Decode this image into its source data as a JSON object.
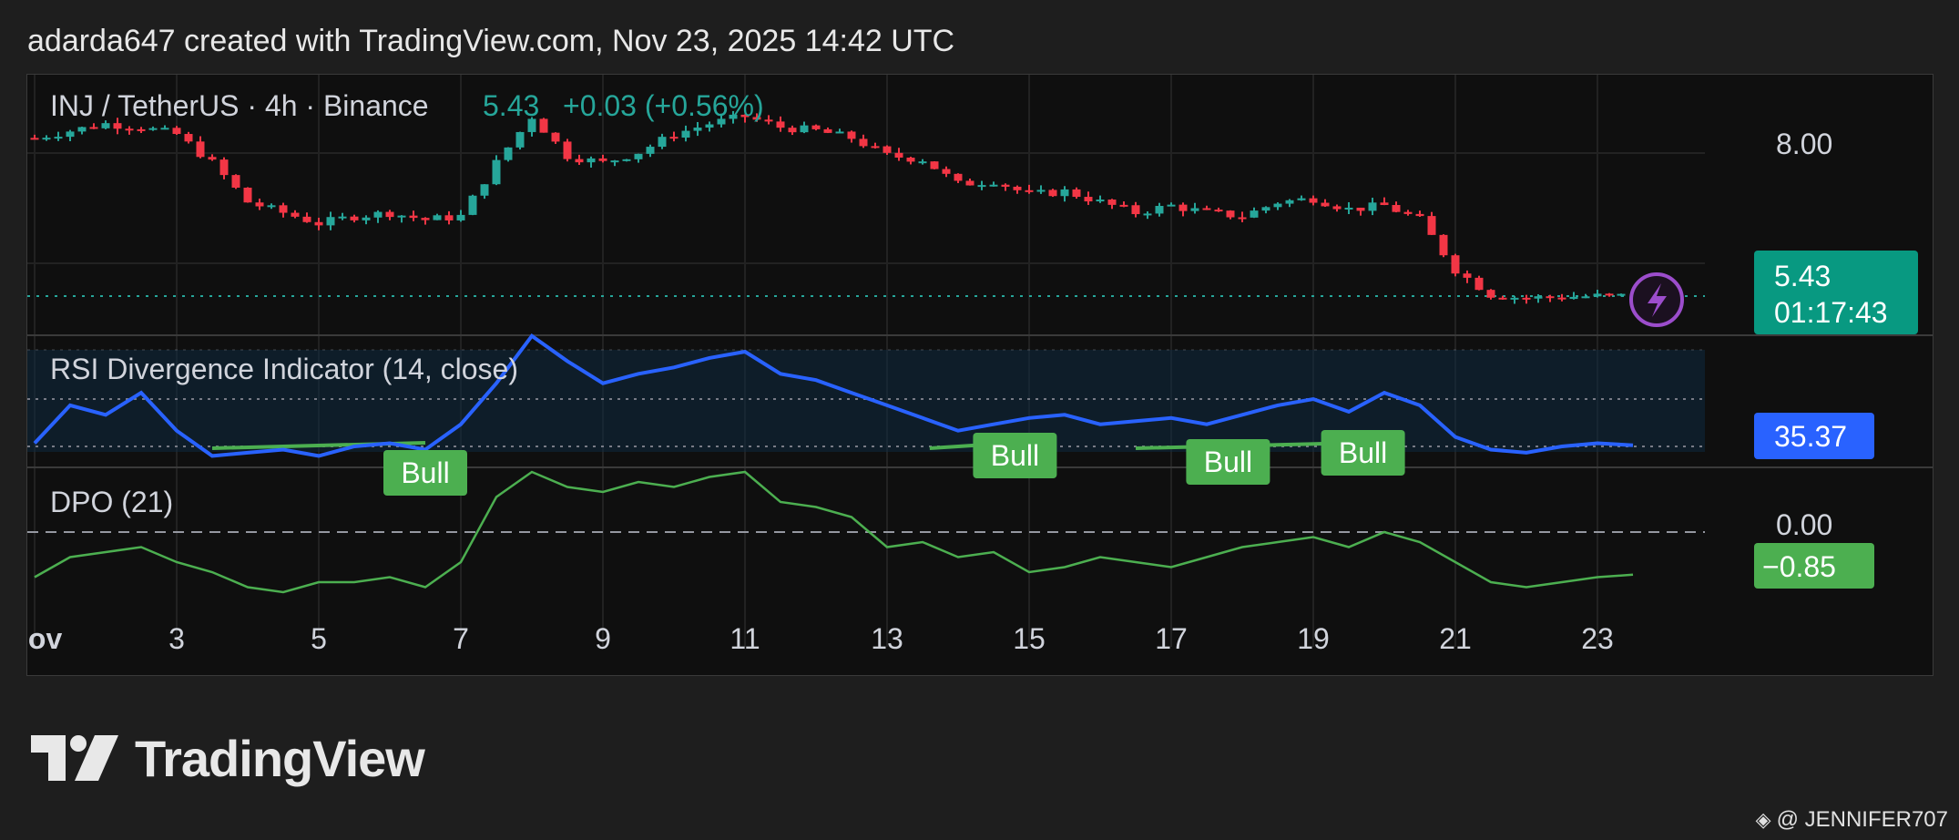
{
  "header": {
    "text": "adarda647 created with TradingView.com, Nov 23, 2025 14:42 UTC"
  },
  "price_pane": {
    "symbol_label": "INJ / TetherUS · 4h · Binance",
    "last_price": "5.43",
    "change": "+0.03 (+0.56%)",
    "axis_label_8": "8.00",
    "price_tag": "5.43",
    "countdown": "01:17:43"
  },
  "rsi_pane": {
    "label": "RSI Divergence Indicator (14, close)",
    "value_tag": "35.37",
    "bull_labels": [
      "Bull",
      "Bull",
      "Bull",
      "Bull"
    ]
  },
  "dpo_pane": {
    "label": "DPO (21)",
    "zero_label": "0.00",
    "value_tag": "−0.85"
  },
  "x_axis": {
    "ticks": [
      "Nov",
      "3",
      "5",
      "7",
      "9",
      "11",
      "13",
      "15",
      "17",
      "19",
      "21",
      "23"
    ]
  },
  "brand": {
    "name": "TradingView",
    "watermark": "@ JENNIFER707"
  },
  "colors": {
    "up": "#26a69a",
    "down": "#f23645",
    "rsi": "#2962ff",
    "dpo": "#4caf50",
    "bull_label": "#4caf50",
    "tag_green": "#089981",
    "tag_blue": "#2962ff",
    "flash": "#9c4dcc"
  },
  "chart_data": [
    {
      "type": "candlestick",
      "title": "INJ / TetherUS · 4h · Binance",
      "x_ticks": [
        "Nov",
        "3",
        "5",
        "7",
        "9",
        "11",
        "13",
        "15",
        "17",
        "19",
        "21",
        "23"
      ],
      "x_range_days": [
        1,
        23.5
      ],
      "yticks": [
        8.0
      ],
      "last": 5.43,
      "close_anchors": [
        [
          1.0,
          7.65
        ],
        [
          1.5,
          7.75
        ],
        [
          2.0,
          7.85
        ],
        [
          2.5,
          7.8
        ],
        [
          3.0,
          7.7
        ],
        [
          3.5,
          7.3
        ],
        [
          4.0,
          6.75
        ],
        [
          4.5,
          6.6
        ],
        [
          5.0,
          6.45
        ],
        [
          5.5,
          6.55
        ],
        [
          6.0,
          6.6
        ],
        [
          6.5,
          6.5
        ],
        [
          7.0,
          6.55
        ],
        [
          7.5,
          7.3
        ],
        [
          8.0,
          7.95
        ],
        [
          8.5,
          7.4
        ],
        [
          9.0,
          7.3
        ],
        [
          9.5,
          7.45
        ],
        [
          10.0,
          7.7
        ],
        [
          10.5,
          7.85
        ],
        [
          11.0,
          7.95
        ],
        [
          11.5,
          7.8
        ],
        [
          12.0,
          7.75
        ],
        [
          12.5,
          7.65
        ],
        [
          13.0,
          7.4
        ],
        [
          13.5,
          7.35
        ],
        [
          14.0,
          7.0
        ],
        [
          14.5,
          7.05
        ],
        [
          15.0,
          6.85
        ],
        [
          15.5,
          6.9
        ],
        [
          16.0,
          6.75
        ],
        [
          16.5,
          6.6
        ],
        [
          17.0,
          6.7
        ],
        [
          17.5,
          6.6
        ],
        [
          18.0,
          6.55
        ],
        [
          18.5,
          6.75
        ],
        [
          19.0,
          6.8
        ],
        [
          19.5,
          6.65
        ],
        [
          20.0,
          6.7
        ],
        [
          20.5,
          6.5
        ],
        [
          21.0,
          5.8
        ],
        [
          21.5,
          5.45
        ],
        [
          22.0,
          5.4
        ],
        [
          22.5,
          5.42
        ],
        [
          23.0,
          5.43
        ],
        [
          23.5,
          5.43
        ]
      ]
    },
    {
      "type": "line",
      "title": "RSI Divergence Indicator (14, close)",
      "last": 35.37,
      "points": [
        [
          1.0,
          36
        ],
        [
          1.5,
          48
        ],
        [
          2.0,
          45
        ],
        [
          2.5,
          52
        ],
        [
          3.0,
          40
        ],
        [
          3.5,
          32
        ],
        [
          4.0,
          33
        ],
        [
          4.5,
          34
        ],
        [
          5.0,
          32
        ],
        [
          5.5,
          35
        ],
        [
          6.0,
          36
        ],
        [
          6.5,
          34
        ],
        [
          7.0,
          42
        ],
        [
          7.5,
          55
        ],
        [
          8.0,
          70
        ],
        [
          8.5,
          62
        ],
        [
          9.0,
          55
        ],
        [
          9.5,
          58
        ],
        [
          10.0,
          60
        ],
        [
          10.5,
          63
        ],
        [
          11.0,
          65
        ],
        [
          11.5,
          58
        ],
        [
          12.0,
          56
        ],
        [
          12.5,
          52
        ],
        [
          13.0,
          48
        ],
        [
          13.5,
          44
        ],
        [
          14.0,
          40
        ],
        [
          14.5,
          42
        ],
        [
          15.0,
          44
        ],
        [
          15.5,
          45
        ],
        [
          16.0,
          42
        ],
        [
          16.5,
          43
        ],
        [
          17.0,
          44
        ],
        [
          17.5,
          42
        ],
        [
          18.0,
          45
        ],
        [
          18.5,
          48
        ],
        [
          19.0,
          50
        ],
        [
          19.5,
          46
        ],
        [
          20.0,
          52
        ],
        [
          20.5,
          48
        ],
        [
          21.0,
          38
        ],
        [
          21.5,
          34
        ],
        [
          22.0,
          33
        ],
        [
          22.5,
          35
        ],
        [
          23.0,
          36
        ],
        [
          23.5,
          35.37
        ]
      ],
      "bull_markers_day": [
        6.5,
        14.8,
        17.8,
        19.7
      ]
    },
    {
      "type": "line",
      "title": "DPO (21)",
      "yticks": [
        0.0
      ],
      "last": -0.85,
      "points": [
        [
          1.0,
          -0.9
        ],
        [
          1.5,
          -0.5
        ],
        [
          2.0,
          -0.4
        ],
        [
          2.5,
          -0.3
        ],
        [
          3.0,
          -0.6
        ],
        [
          3.5,
          -0.8
        ],
        [
          4.0,
          -1.1
        ],
        [
          4.5,
          -1.2
        ],
        [
          5.0,
          -1.0
        ],
        [
          5.5,
          -1.0
        ],
        [
          6.0,
          -0.9
        ],
        [
          6.5,
          -1.1
        ],
        [
          7.0,
          -0.6
        ],
        [
          7.5,
          0.7
        ],
        [
          8.0,
          1.2
        ],
        [
          8.5,
          0.9
        ],
        [
          9.0,
          0.8
        ],
        [
          9.5,
          1.0
        ],
        [
          10.0,
          0.9
        ],
        [
          10.5,
          1.1
        ],
        [
          11.0,
          1.2
        ],
        [
          11.5,
          0.6
        ],
        [
          12.0,
          0.5
        ],
        [
          12.5,
          0.3
        ],
        [
          13.0,
          -0.3
        ],
        [
          13.5,
          -0.2
        ],
        [
          14.0,
          -0.5
        ],
        [
          14.5,
          -0.4
        ],
        [
          15.0,
          -0.8
        ],
        [
          15.5,
          -0.7
        ],
        [
          16.0,
          -0.5
        ],
        [
          16.5,
          -0.6
        ],
        [
          17.0,
          -0.7
        ],
        [
          17.5,
          -0.5
        ],
        [
          18.0,
          -0.3
        ],
        [
          18.5,
          -0.2
        ],
        [
          19.0,
          -0.1
        ],
        [
          19.5,
          -0.3
        ],
        [
          20.0,
          0.0
        ],
        [
          20.5,
          -0.2
        ],
        [
          21.0,
          -0.6
        ],
        [
          21.5,
          -1.0
        ],
        [
          22.0,
          -1.1
        ],
        [
          22.5,
          -1.0
        ],
        [
          23.0,
          -0.9
        ],
        [
          23.5,
          -0.85
        ]
      ]
    }
  ]
}
